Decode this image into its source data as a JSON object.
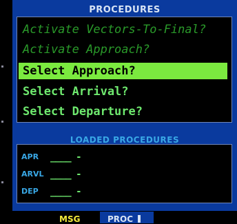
{
  "title": "PROCEDURES",
  "menu": [
    {
      "label": "Activate Vectors-To-Final?",
      "state": "disabled"
    },
    {
      "label": "Activate Approach?",
      "state": "disabled"
    },
    {
      "label": "Select Approach?",
      "state": "selected"
    },
    {
      "label": "Select Arrival?",
      "state": "enabled"
    },
    {
      "label": "Select Departure?",
      "state": "enabled"
    }
  ],
  "loaded": {
    "title": "LOADED PROCEDURES",
    "rows": [
      {
        "label": "APR",
        "value": "____ -"
      },
      {
        "label": "ARVL",
        "value": "____ -"
      },
      {
        "label": "DEP",
        "value": "____ -"
      }
    ]
  },
  "status": {
    "msg": "MSG",
    "proc": "PROC"
  },
  "colors": {
    "panel": "#0a3a9e",
    "selected_bg": "#7bea3f",
    "enabled_text": "#6ee86e",
    "disabled_text": "#2a9a2a",
    "section_title": "#39a8e6",
    "msg": "#f3e93b"
  }
}
